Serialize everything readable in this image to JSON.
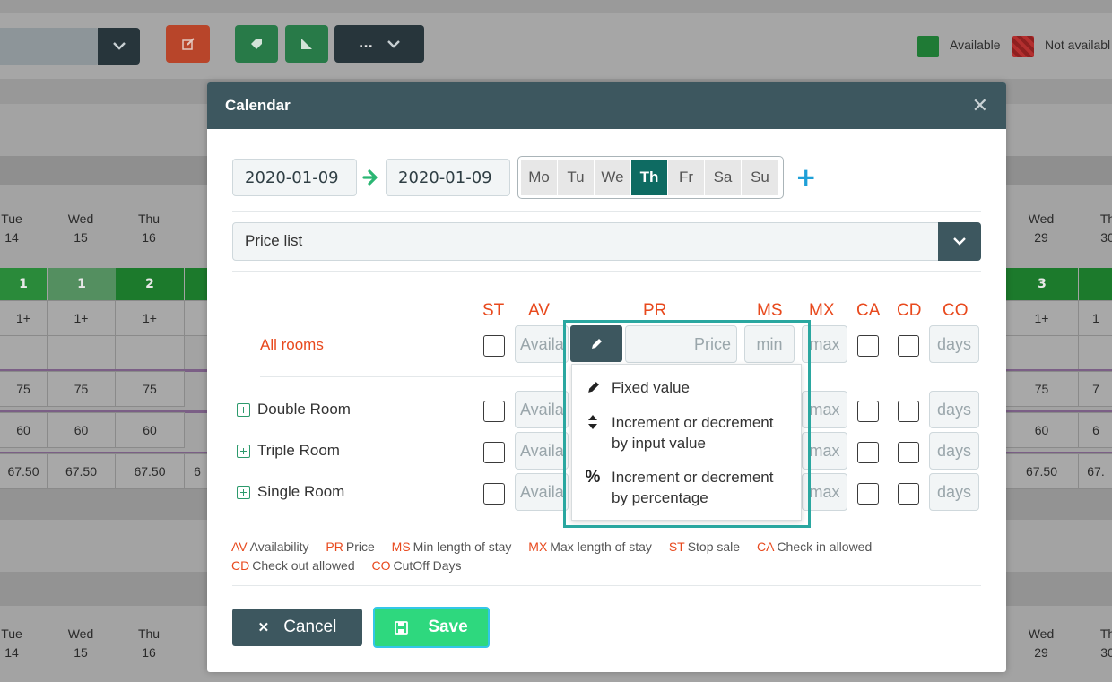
{
  "background": {
    "dots_label": "...",
    "legend": {
      "available": "Available",
      "not_available": "Not availabl"
    },
    "days_left_top": [
      {
        "name": "Tue",
        "num": "14"
      },
      {
        "name": "Wed",
        "num": "15"
      },
      {
        "name": "Thu",
        "num": "16"
      }
    ],
    "days_right_top": [
      {
        "name": "Wed",
        "num": "29"
      },
      {
        "name": "Th",
        "num": "30"
      }
    ],
    "days_left_bottom": [
      {
        "name": "Tue",
        "num": "14"
      },
      {
        "name": "Wed",
        "num": "15"
      },
      {
        "name": "Thu",
        "num": "16"
      }
    ],
    "days_right_bottom": [
      {
        "name": "Wed",
        "num": "29"
      },
      {
        "name": "Th",
        "num": "30"
      }
    ],
    "green_left": [
      "1",
      "1",
      "2"
    ],
    "green_right": [
      "3"
    ],
    "row_minstay_left": [
      "1+",
      "1+",
      "1+"
    ],
    "row_minstay_right": [
      "1+",
      "1"
    ],
    "row_a_left": [
      "75",
      "75",
      "75"
    ],
    "row_a_right": [
      "75",
      "7"
    ],
    "row_b_left": [
      "60",
      "60",
      "60"
    ],
    "row_b_right": [
      "60",
      "6"
    ],
    "row_c_left": [
      "67.50",
      "67.50",
      "67.50",
      "6"
    ],
    "row_c_right": [
      "67.50",
      "67."
    ]
  },
  "modal": {
    "title": "Calendar",
    "date_from": "2020-01-09",
    "date_to": "2020-01-09",
    "weekdays": [
      "Mo",
      "Tu",
      "We",
      "Th",
      "Fr",
      "Sa",
      "Su"
    ],
    "active_weekday": "Th",
    "price_list_label": "Price list",
    "column_heads": {
      "st": "ST",
      "av": "AV",
      "pr": "PR",
      "ms": "MS",
      "mx": "MX",
      "ca": "CA",
      "cd": "CD",
      "co": "CO"
    },
    "rows": [
      {
        "label": "All rooms",
        "av": "Availa",
        "ms": "min",
        "mx": "max",
        "co": "days"
      },
      {
        "label": "Double Room",
        "av": "Availa",
        "mx": "max",
        "co": "days"
      },
      {
        "label": "Triple Room",
        "av": "Availa",
        "mx": "max",
        "co": "days"
      },
      {
        "label": "Single Room",
        "av": "Availa",
        "mx": "max",
        "co": "days"
      }
    ],
    "price_placeholder": "Price",
    "price_mode_menu": [
      {
        "icon": "pencil-icon",
        "line1": "Fixed value",
        "line2": ""
      },
      {
        "icon": "sort-icon",
        "line1": "Increment or decrement",
        "line2": "by input value"
      },
      {
        "icon": "percent-icon",
        "line1": "Increment or decrement",
        "line2": "by percentage"
      }
    ],
    "legend": [
      {
        "abbr": "AV",
        "text": "Availability"
      },
      {
        "abbr": "PR",
        "text": "Price"
      },
      {
        "abbr": "MS",
        "text": "Min length of stay"
      },
      {
        "abbr": "MX",
        "text": "Max length of stay"
      },
      {
        "abbr": "ST",
        "text": "Stop sale"
      },
      {
        "abbr": "CA",
        "text": "Check in allowed"
      },
      {
        "abbr": "CD",
        "text": "Check out allowed"
      },
      {
        "abbr": "CO",
        "text": "CutOff Days"
      }
    ],
    "cancel_label": "Cancel",
    "save_label": "Save"
  },
  "colors": {
    "header": "#3d575f",
    "accent_orange": "#e8491d",
    "active_day": "#0e6b62",
    "save": "#2ed87e",
    "highlight": "#2aa7a0"
  }
}
